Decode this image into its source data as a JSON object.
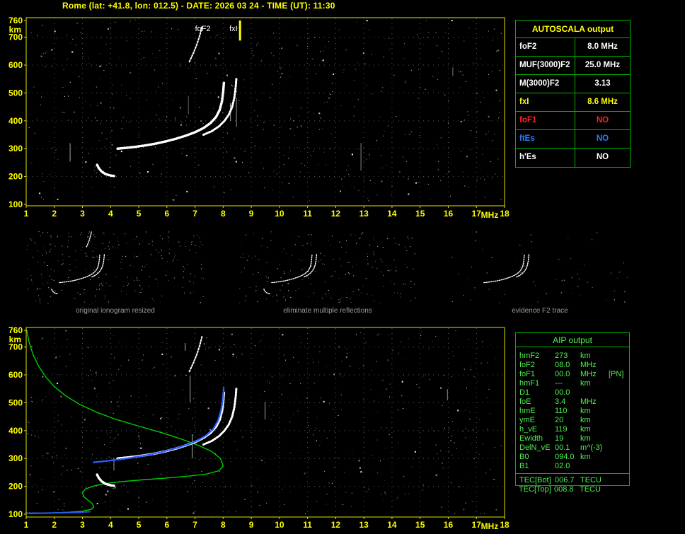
{
  "title": "Rome (lat: +41.8, lon: 012.5) - DATE: 2026 03 24 - TIME (UT): 11:30",
  "colors": {
    "background": "#000000",
    "axis_yellow": "#ffff00",
    "plot_frame": "#e4e400",
    "table_border": "#00b400",
    "trace_white": "#ffffff",
    "profile_green": "#00cc00",
    "restored_blue": "#2a5cff",
    "warning_red": "#ff2222",
    "info_blue": "#2d7dff",
    "aip_green": "#4ef04e",
    "caption_gray": "#9c9c9c"
  },
  "autoscala_table": {
    "header": "AUTOSCALA output",
    "rows": [
      {
        "label": "foF2",
        "value": "8.0 MHz",
        "color": "white"
      },
      {
        "label": "MUF(3000)F2",
        "value": "25.0 MHz",
        "color": "white"
      },
      {
        "label": "M(3000)F2",
        "value": "3.13",
        "color": "white"
      },
      {
        "label": "fxI",
        "value": "8.6 MHz",
        "color": "yellow"
      },
      {
        "label": "foF1",
        "value": "NO",
        "color": "red"
      },
      {
        "label": "ftEs",
        "value": "NO",
        "color": "blue"
      },
      {
        "label": "h'Es",
        "value": "NO",
        "color": "white"
      }
    ]
  },
  "aip_table": {
    "header": "AIP output",
    "rows": [
      {
        "name": "hmF2",
        "value": "273",
        "unit": "km",
        "note": ""
      },
      {
        "name": "foF2",
        "value": "08.0",
        "unit": "MHz",
        "note": ""
      },
      {
        "name": "foF1",
        "value": "00.0",
        "unit": "MHz",
        "note": "[PN]"
      },
      {
        "name": "hmF1",
        "value": "---",
        "unit": "km",
        "note": ""
      },
      {
        "name": "D1",
        "value": "00.0",
        "unit": "",
        "note": ""
      },
      {
        "name": "foE",
        "value": "3.4",
        "unit": "MHz",
        "note": ""
      },
      {
        "name": "hmE",
        "value": "110",
        "unit": "km",
        "note": ""
      },
      {
        "name": "ymE",
        "value": "20",
        "unit": "km",
        "note": ""
      },
      {
        "name": "h_vE",
        "value": "119",
        "unit": "km",
        "note": ""
      },
      {
        "name": "Ewidth",
        "value": "19",
        "unit": "km",
        "note": ""
      },
      {
        "name": "DelN_vE",
        "value": "00.1",
        "unit": "m^(-3)",
        "note": ""
      },
      {
        "name": "B0",
        "value": "094.0",
        "unit": "km",
        "note": ""
      },
      {
        "name": "B1",
        "value": "02.0",
        "unit": "",
        "note": ""
      }
    ],
    "tec_rows": [
      {
        "name": "TEC[Bot]",
        "value": "006.7",
        "unit": "TECU",
        "note": ""
      },
      {
        "name": "TEC[Top]",
        "value": "008.8",
        "unit": "TECU",
        "note": ""
      }
    ]
  },
  "thumbnails": [
    {
      "caption": "original ionogram resized"
    },
    {
      "caption": "eliminate multiple reflections"
    },
    {
      "caption": "evidence F2 trace"
    }
  ],
  "chart_data": [
    {
      "id": "ionogram-top",
      "type": "scatter",
      "title": "recorded ionogram with AUTOSCALA markers",
      "xlabel": "MHz",
      "ylabel": "km",
      "xlim": [
        1,
        18
      ],
      "ylim": [
        100,
        760
      ],
      "xticks": [
        1,
        2,
        3,
        4,
        5,
        6,
        7,
        8,
        9,
        10,
        11,
        12,
        13,
        14,
        15,
        16,
        17,
        18
      ],
      "yticks": [
        100,
        200,
        300,
        400,
        500,
        600,
        700,
        760
      ],
      "grid": "dotted",
      "annotations": [
        {
          "type": "text",
          "text": "foF2",
          "x": 7.0,
          "y": 722,
          "color": "#ffffff"
        },
        {
          "type": "text",
          "text": "fxI",
          "x": 8.22,
          "y": 722,
          "color": "#ffffff"
        },
        {
          "type": "vline",
          "x": 8.6,
          "y1": 760,
          "y2": 688,
          "color": "#ffff00"
        }
      ],
      "series": [
        {
          "name": "F2-O-trace",
          "color": "#ffffff",
          "width": 3.5,
          "style": "dotted",
          "points": [
            [
              4.25,
              300
            ],
            [
              4.55,
              303
            ],
            [
              4.9,
              307
            ],
            [
              5.25,
              312
            ],
            [
              5.6,
              318
            ],
            [
              5.95,
              326
            ],
            [
              6.3,
              335
            ],
            [
              6.65,
              346
            ],
            [
              7.0,
              359
            ],
            [
              7.3,
              374
            ],
            [
              7.55,
              392
            ],
            [
              7.75,
              414
            ],
            [
              7.88,
              440
            ],
            [
              7.96,
              472
            ],
            [
              8.0,
              505
            ],
            [
              8.03,
              540
            ]
          ]
        },
        {
          "name": "F2-X-trace",
          "color": "#ffffff",
          "width": 3,
          "style": "dotted",
          "points": [
            [
              7.3,
              350
            ],
            [
              7.6,
              363
            ],
            [
              7.85,
              380
            ],
            [
              8.05,
              400
            ],
            [
              8.2,
              422
            ],
            [
              8.32,
              450
            ],
            [
              8.4,
              485
            ],
            [
              8.45,
              525
            ],
            [
              8.47,
              552
            ]
          ]
        },
        {
          "name": "Es-trace",
          "color": "#ffffff",
          "width": 3.5,
          "style": "dotted",
          "points": [
            [
              3.52,
              242
            ],
            [
              3.58,
              230
            ],
            [
              3.68,
              218
            ],
            [
              3.82,
              209
            ],
            [
              3.98,
              204
            ],
            [
              4.12,
              202
            ]
          ]
        },
        {
          "name": "F2-second-reflection",
          "color": "#ffffff",
          "width": 2,
          "style": "dotted",
          "points": [
            [
              6.8,
              612
            ],
            [
              6.95,
              645
            ],
            [
              7.08,
              678
            ],
            [
              7.18,
              710
            ],
            [
              7.26,
              742
            ]
          ]
        }
      ]
    },
    {
      "id": "ionogram-bottom",
      "type": "scatter",
      "title": "ionogram with restored trace and electron density profile",
      "xlabel": "MHz",
      "ylabel": "km",
      "xlim": [
        1,
        18
      ],
      "ylim": [
        100,
        760
      ],
      "xticks": [
        1,
        2,
        3,
        4,
        5,
        6,
        7,
        8,
        9,
        10,
        11,
        12,
        13,
        14,
        15,
        16,
        17,
        18
      ],
      "yticks": [
        100,
        200,
        300,
        400,
        500,
        600,
        700,
        760
      ],
      "grid": "dotted",
      "annotations": [],
      "series": [
        {
          "name": "electron-density-profile",
          "color": "#00cc00",
          "width": 1.4,
          "style": "solid",
          "points": [
            [
              1.02,
              760
            ],
            [
              1.1,
              718
            ],
            [
              1.25,
              672
            ],
            [
              1.45,
              630
            ],
            [
              1.7,
              592
            ],
            [
              2.0,
              558
            ],
            [
              2.4,
              525
            ],
            [
              2.9,
              494
            ],
            [
              3.5,
              466
            ],
            [
              4.2,
              440
            ],
            [
              5.0,
              416
            ],
            [
              5.8,
              393
            ],
            [
              6.5,
              370
            ],
            [
              7.1,
              348
            ],
            [
              7.6,
              325
            ],
            [
              7.9,
              300
            ],
            [
              8.0,
              273
            ],
            [
              7.85,
              256
            ],
            [
              7.4,
              244
            ],
            [
              6.7,
              236
            ],
            [
              5.9,
              229
            ],
            [
              5.1,
              223
            ],
            [
              4.4,
              217
            ],
            [
              3.8,
              210
            ],
            [
              3.4,
              201
            ],
            [
              3.1,
              190
            ],
            [
              3.0,
              177
            ],
            [
              3.05,
              163
            ],
            [
              3.2,
              150
            ],
            [
              3.35,
              138
            ],
            [
              3.4,
              126
            ],
            [
              3.3,
              117
            ],
            [
              3.0,
              111
            ],
            [
              2.5,
              107
            ],
            [
              1.8,
              104
            ],
            [
              1.1,
              102
            ]
          ]
        },
        {
          "name": "F2-O-trace",
          "color": "#ffffff",
          "width": 3.5,
          "style": "dotted",
          "points": [
            [
              4.25,
              300
            ],
            [
              4.55,
              303
            ],
            [
              4.9,
              307
            ],
            [
              5.25,
              312
            ],
            [
              5.6,
              318
            ],
            [
              5.95,
              326
            ],
            [
              6.3,
              335
            ],
            [
              6.65,
              346
            ],
            [
              7.0,
              359
            ],
            [
              7.3,
              374
            ],
            [
              7.55,
              392
            ],
            [
              7.75,
              414
            ],
            [
              7.88,
              440
            ],
            [
              7.96,
              472
            ],
            [
              8.0,
              505
            ],
            [
              8.03,
              540
            ]
          ]
        },
        {
          "name": "F2-X-trace",
          "color": "#ffffff",
          "width": 3,
          "style": "dotted",
          "points": [
            [
              7.3,
              350
            ],
            [
              7.6,
              363
            ],
            [
              7.85,
              380
            ],
            [
              8.05,
              400
            ],
            [
              8.2,
              422
            ],
            [
              8.32,
              450
            ],
            [
              8.4,
              485
            ],
            [
              8.45,
              525
            ],
            [
              8.47,
              552
            ]
          ]
        },
        {
          "name": "Es-trace",
          "color": "#ffffff",
          "width": 3.5,
          "style": "dotted",
          "points": [
            [
              3.52,
              242
            ],
            [
              3.58,
              230
            ],
            [
              3.68,
              218
            ],
            [
              3.82,
              209
            ],
            [
              3.98,
              204
            ],
            [
              4.12,
              202
            ]
          ]
        },
        {
          "name": "F2-second-reflection",
          "color": "#ffffff",
          "width": 2,
          "style": "dotted",
          "points": [
            [
              6.8,
              612
            ],
            [
              6.95,
              645
            ],
            [
              7.08,
              678
            ],
            [
              7.18,
              710
            ],
            [
              7.26,
              742
            ]
          ]
        },
        {
          "name": "restored-F2-trace",
          "color": "#2a5cff",
          "width": 2.5,
          "style": "dotted",
          "points": [
            [
              3.4,
              286
            ],
            [
              3.75,
              290
            ],
            [
              4.1,
              294
            ],
            [
              4.5,
              299
            ],
            [
              4.95,
              306
            ],
            [
              5.4,
              314
            ],
            [
              5.85,
              324
            ],
            [
              6.3,
              336
            ],
            [
              6.75,
              350
            ],
            [
              7.1,
              365
            ],
            [
              7.4,
              383
            ],
            [
              7.65,
              406
            ],
            [
              7.82,
              436
            ],
            [
              7.93,
              475
            ],
            [
              8.0,
              520
            ],
            [
              8.02,
              555
            ]
          ]
        },
        {
          "name": "restored-E-trace",
          "color": "#2a5cff",
          "width": 2,
          "style": "dotted",
          "points": [
            [
              1.0,
              104
            ],
            [
              1.6,
              104
            ],
            [
              2.2,
              105
            ],
            [
              2.8,
              106
            ],
            [
              3.25,
              109
            ]
          ]
        }
      ]
    }
  ]
}
